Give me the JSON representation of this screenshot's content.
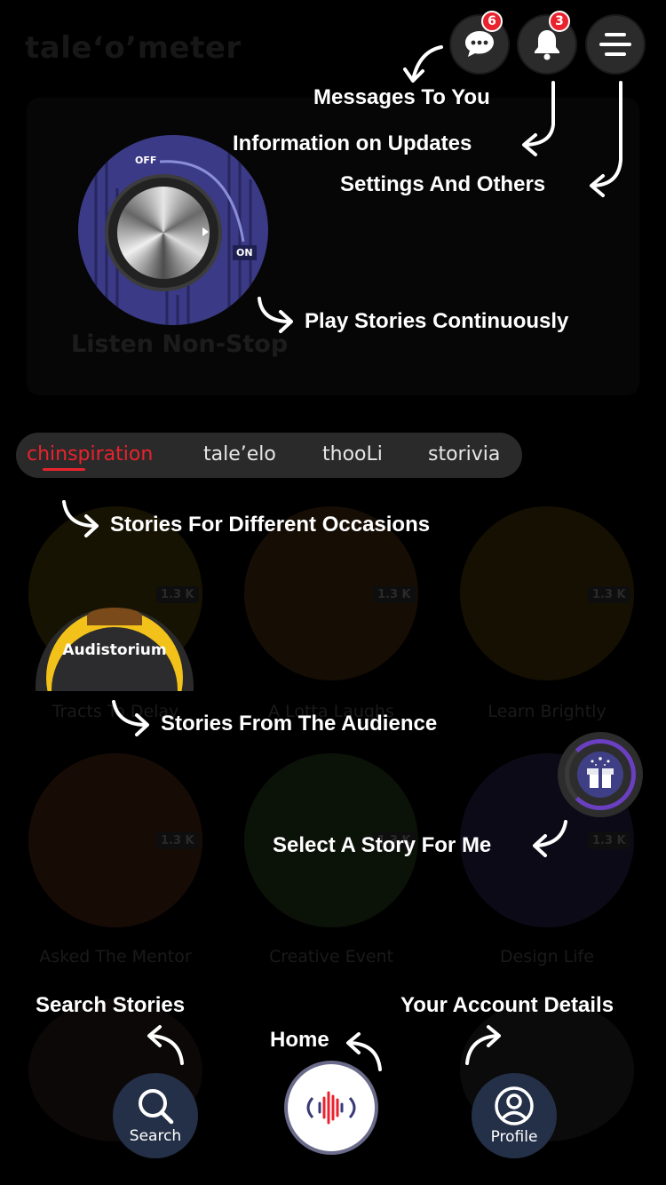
{
  "app": {
    "title": "tale‘o’meter"
  },
  "hero": {
    "listen_label": "Listen Non-Stop",
    "dial_off": "OFF",
    "dial_on": "ON"
  },
  "header": {
    "messages_badge": "6",
    "notifications_badge": "3"
  },
  "tabs": [
    {
      "label": "chinspiration",
      "active": true
    },
    {
      "label": "tale’elo",
      "active": false
    },
    {
      "label": "thooLi",
      "active": false
    },
    {
      "label": "storivia",
      "active": false
    }
  ],
  "audistorium": {
    "label": "Audistorium"
  },
  "stories": [
    {
      "title": "Tracts To Delay",
      "views": "1.3 K"
    },
    {
      "title": "A Lotta Laughs",
      "views": "1.3 K"
    },
    {
      "title": "Learn Brightly",
      "views": "1.3 K"
    },
    {
      "title": "Asked The Mentor",
      "views": "1.3 K"
    },
    {
      "title": "Creative Event",
      "views": "1.3 K"
    },
    {
      "title": "Design Life",
      "views": "1.3 K"
    }
  ],
  "coach_marks": {
    "messages": "Messages To You",
    "updates": "Information on Updates",
    "settings": "Settings And Others",
    "play": "Play Stories Continuously",
    "occasions": "Stories For Different Occasions",
    "audience": "Stories From The Audience",
    "select": "Select A Story For Me",
    "search": "Search Stories",
    "home": "Home",
    "account": "Your Account Details"
  },
  "nav": {
    "search_label": "Search",
    "profile_label": "Profile"
  },
  "colors": {
    "accent": "#e8232d",
    "dial_bg": "#3b3a86",
    "nav_bg": "#243047",
    "gift_ring": "#6a3fc2"
  }
}
